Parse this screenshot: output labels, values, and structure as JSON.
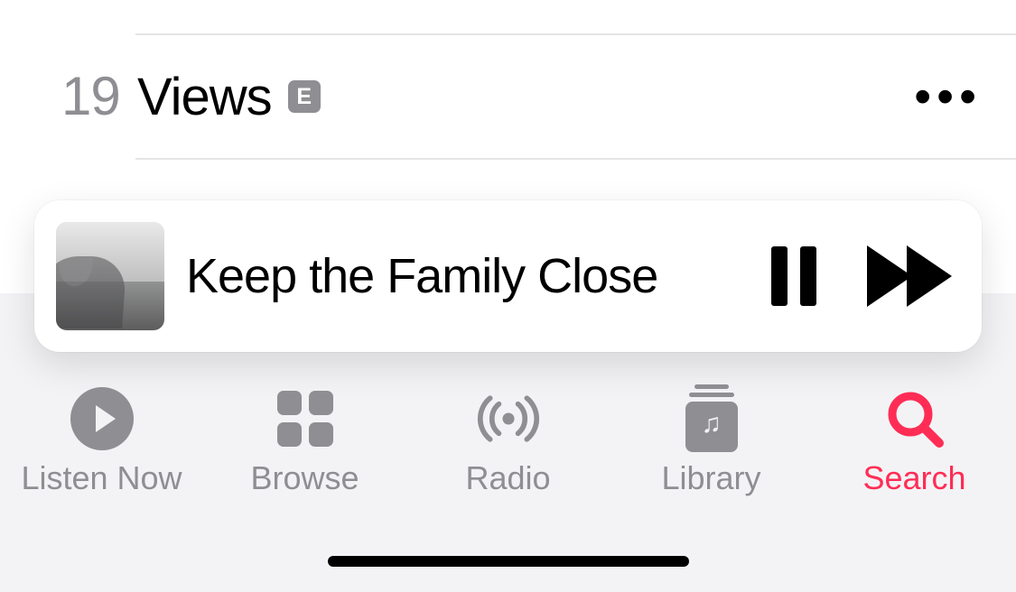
{
  "list": {
    "track_number": "19",
    "title": "Views",
    "explicit_label": "E"
  },
  "now_playing": {
    "title": "Keep the Family Close"
  },
  "tabs": {
    "listen_now": "Listen Now",
    "browse": "Browse",
    "radio": "Radio",
    "library": "Library",
    "search": "Search",
    "active": "search"
  },
  "colors": {
    "accent": "#ff2d55",
    "inactive": "#8e8e93"
  }
}
